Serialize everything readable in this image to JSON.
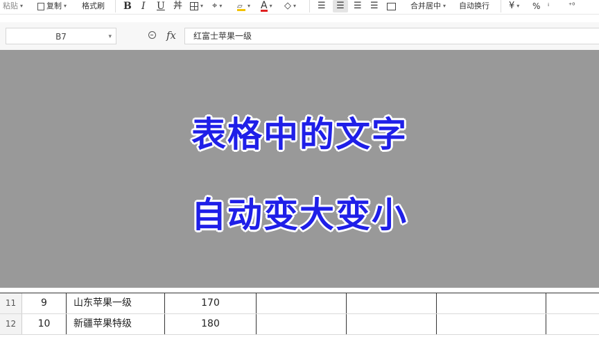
{
  "ribbon": {
    "paste": "粘贴",
    "copy": "复制",
    "format_painter": "格式刷",
    "bold": "B",
    "italic": "I",
    "underline": "U",
    "font_color": "A",
    "merge_center": "合并居中",
    "wrap_text": "自动换行"
  },
  "formula_bar": {
    "cell_ref": "B7",
    "fx": "fx",
    "formula": "红富士苹果一级"
  },
  "overlay": {
    "line1": "表格中的文字",
    "line2": "自动变大变小",
    "text_color": "#1f1fe8",
    "background": "#999999"
  },
  "rows": [
    {
      "row_num": "11",
      "index": "9",
      "name": "山东苹果一级",
      "value": "170"
    },
    {
      "row_num": "12",
      "index": "10",
      "name": "新疆苹果特级",
      "value": "180"
    }
  ]
}
